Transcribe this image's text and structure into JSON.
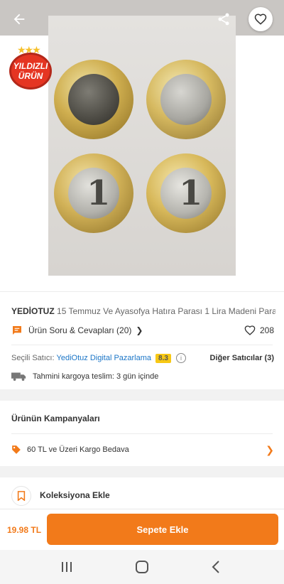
{
  "colors": {
    "accent": "#f27a1a",
    "link": "#1c76c7",
    "score_bg": "#f7c815",
    "badge_red": "#e53522"
  },
  "badge": {
    "line1": "YILDIZLI",
    "line2": "ÜRÜN"
  },
  "product": {
    "brand": "YEDİOTUZ",
    "title": "15 Temmuz Ve Ayasofya Hatıra Parası 1 Lira Madeni Para",
    "qa_label": "Ürün Soru & Cevapları (20)",
    "likes": "208"
  },
  "seller": {
    "label": "Seçili Satıcı:",
    "name": "YediOtuz Digital Pazarlama",
    "score": "8.3",
    "others": "Diğer Satıcılar (3)"
  },
  "shipping": {
    "text": "Tahmini kargoya teslim: 3 gün içinde"
  },
  "campaigns": {
    "title": "Ürünün Kampanyaları",
    "items": [
      {
        "label": "60 TL ve Üzeri Kargo Bedava"
      }
    ]
  },
  "collection": {
    "label": "Koleksiyona Ekle"
  },
  "bottom": {
    "price": "19.98 TL",
    "cart_label": "Sepete Ekle"
  },
  "icons": [
    "back-arrow-icon",
    "share-icon",
    "heart-icon",
    "chat-icon",
    "chevron-right-icon",
    "info-icon",
    "truck-icon",
    "tag-icon",
    "bookmark-icon",
    "recents-icon",
    "home-icon",
    "back-icon"
  ]
}
